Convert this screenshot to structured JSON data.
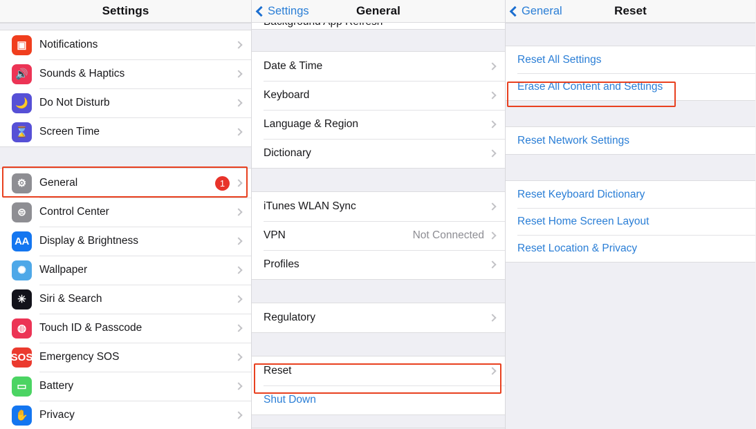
{
  "colors": {
    "accent_blue": "#2a7ed6",
    "highlight_red": "#e8401f",
    "badge_red": "#e8332a",
    "value_gray": "#8d8d93",
    "group_bg": "#efeff4"
  },
  "panels": {
    "settings": {
      "title": "Settings",
      "items": [
        {
          "label": "Notifications",
          "icon": "notifications-icon",
          "icon_glyph": "▣",
          "icon_class": "ic-notif",
          "chevron": true
        },
        {
          "label": "Sounds & Haptics",
          "icon": "speaker-icon",
          "icon_glyph": "🔊",
          "icon_class": "ic-sounds",
          "chevron": true
        },
        {
          "label": "Do Not Disturb",
          "icon": "moon-icon",
          "icon_glyph": "🌙",
          "icon_class": "ic-dnd",
          "chevron": true
        },
        {
          "label": "Screen Time",
          "icon": "hourglass-icon",
          "icon_glyph": "⌛",
          "icon_class": "ic-screentime",
          "chevron": true
        }
      ],
      "items2": [
        {
          "label": "General",
          "icon": "gear-icon",
          "icon_glyph": "⚙",
          "icon_class": "ic-general",
          "badge": "1",
          "chevron": true,
          "highlighted": true
        },
        {
          "label": "Control Center",
          "icon": "toggles-icon",
          "icon_glyph": "⊜",
          "icon_class": "ic-control",
          "chevron": true
        },
        {
          "label": "Display & Brightness",
          "icon": "text-size-icon",
          "icon_glyph": "AA",
          "icon_class": "ic-display",
          "chevron": true
        },
        {
          "label": "Wallpaper",
          "icon": "flower-icon",
          "icon_glyph": "✺",
          "icon_class": "ic-wallpaper",
          "chevron": true
        },
        {
          "label": "Siri & Search",
          "icon": "siri-icon",
          "icon_glyph": "✳",
          "icon_class": "ic-siri",
          "chevron": true
        },
        {
          "label": "Touch ID & Passcode",
          "icon": "fingerprint-icon",
          "icon_glyph": "◍",
          "icon_class": "ic-touchid",
          "chevron": true
        },
        {
          "label": "Emergency SOS",
          "icon": "sos-icon",
          "icon_glyph": "SOS",
          "icon_class": "ic-sos",
          "chevron": true
        },
        {
          "label": "Battery",
          "icon": "battery-icon",
          "icon_glyph": "▭",
          "icon_class": "ic-battery",
          "chevron": true
        },
        {
          "label": "Privacy",
          "icon": "hand-icon",
          "icon_glyph": "✋",
          "icon_class": "ic-privacy",
          "chevron": true
        }
      ]
    },
    "general": {
      "title": "General",
      "back_label": "Settings",
      "partial_row_label": "Background App Refresh",
      "group1": [
        {
          "label": "Date & Time",
          "chevron": true
        },
        {
          "label": "Keyboard",
          "chevron": true
        },
        {
          "label": "Language & Region",
          "chevron": true
        },
        {
          "label": "Dictionary",
          "chevron": true
        }
      ],
      "group2": [
        {
          "label": "iTunes WLAN Sync",
          "chevron": true
        },
        {
          "label": "VPN",
          "value": "Not Connected",
          "chevron": true
        },
        {
          "label": "Profiles",
          "chevron": true
        }
      ],
      "group3": [
        {
          "label": "Regulatory",
          "chevron": true
        }
      ],
      "group4": [
        {
          "label": "Reset",
          "chevron": true,
          "highlighted": true
        },
        {
          "label": "Shut Down",
          "blue": true
        }
      ]
    },
    "reset": {
      "title": "Reset",
      "back_label": "General",
      "group1": [
        {
          "label": "Reset All Settings"
        },
        {
          "label": "Erase All Content and Settings",
          "highlighted": true
        }
      ],
      "group2": [
        {
          "label": "Reset Network Settings"
        }
      ],
      "group3": [
        {
          "label": "Reset Keyboard Dictionary"
        },
        {
          "label": "Reset Home Screen Layout"
        },
        {
          "label": "Reset Location & Privacy"
        }
      ]
    }
  }
}
